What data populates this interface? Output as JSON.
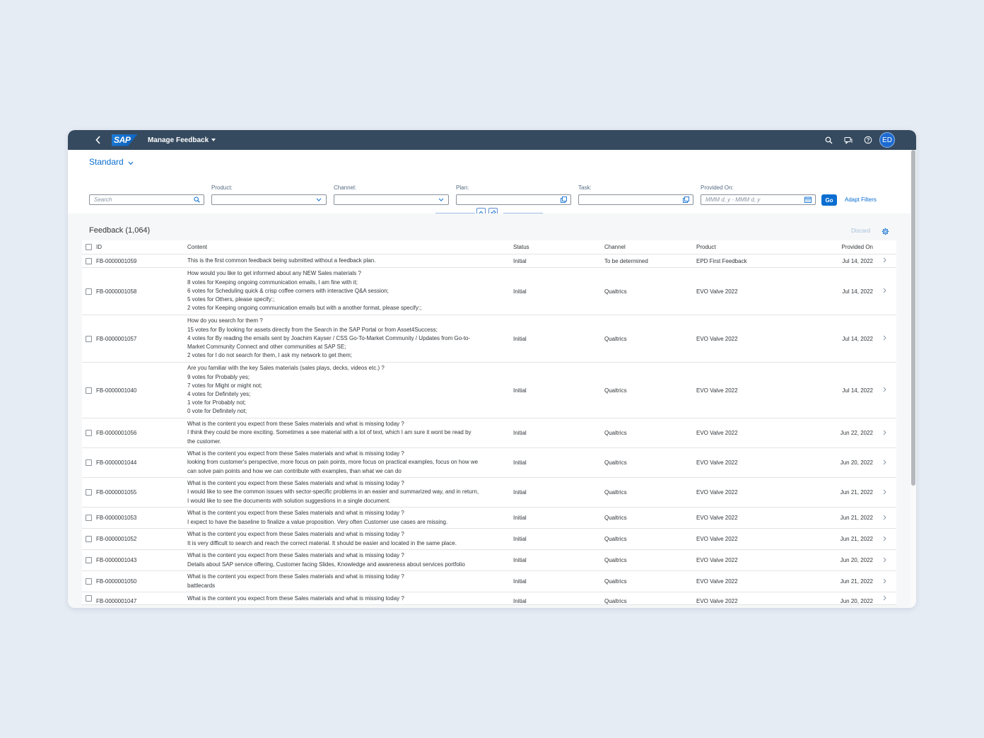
{
  "shell": {
    "app_title": "Manage Feedback",
    "logo_text": "SAP",
    "avatar_initials": "ED",
    "icons": [
      "back-icon",
      "search-icon",
      "notifications-icon",
      "help-icon"
    ]
  },
  "filterbar": {
    "variant": "Standard",
    "search_placeholder": "Search",
    "product_label": "Product:",
    "channel_label": "Channel:",
    "plan_label": "Plan:",
    "task_label": "Task:",
    "provided_on_label": "Provided On:",
    "date_placeholder": "MMM d, y - MMM d, y",
    "go_label": "Go",
    "adapt_filters_label": "Adapt Filters"
  },
  "table": {
    "title": "Feedback (1,064)",
    "discard_label": "Discard",
    "columns": {
      "id": "ID",
      "content": "Content",
      "status": "Status",
      "channel": "Channel",
      "product": "Product",
      "provided_on": "Provided On"
    },
    "rows": [
      {
        "id": "FB-0000001059",
        "content": "This is the first common feedback being submitted without a feedback plan.",
        "status": "Initial",
        "channel": "To be determined",
        "product": "EPD First Feedback",
        "date": "Jul 14, 2022"
      },
      {
        "id": "FB-0000001058",
        "content": "How would you like to get informed about any NEW Sales materials ?\n8 votes for Keeping ongoing communication emails, I am fine with it;\n6 votes for Scheduling quick & crisp coffee corners with interactive Q&A session;\n5 votes for Others, please specify:;\n2 votes for Keeping ongoing communication emails but with a another format, please specify:;",
        "status": "Initial",
        "channel": "Qualtrics",
        "product": "EVO Valve 2022",
        "date": "Jul 14, 2022"
      },
      {
        "id": "FB-0000001057",
        "content": "How do you search for them ?\n15 votes for By looking for assets directly from the Search in the SAP Portal or from Asset4Success;\n4 votes for By reading the emails sent by Joachim Kayser / CSS Go-To-Market Community / Updates from Go-to-\nMarket Community Connect and other communities at SAP SE;\n2 votes for I do not search for them, I ask my network to get them;",
        "status": "Initial",
        "channel": "Qualtrics",
        "product": "EVO Valve 2022",
        "date": "Jul 14, 2022"
      },
      {
        "id": "FB-0000001040",
        "content": "Are you familiar with the key Sales materials (sales plays, decks, videos etc.) ?\n9 votes for Probably yes;\n7 votes for Might or might not;\n4 votes for Definitely yes;\n1 vote for Probably not;\n0 vote for Definitely not;",
        "status": "Initial",
        "channel": "Qualtrics",
        "product": "EVO Valve 2022",
        "date": "Jul 14, 2022"
      },
      {
        "id": "FB-0000001056",
        "content": "What is the content you expect from these Sales materials and what is missing today ?\nI think they could be more exciting. Sometimes a see material with a lot of text, which I am sure it wont be read by\nthe customer.",
        "status": "Initial",
        "channel": "Qualtrics",
        "product": "EVO Valve 2022",
        "date": "Jun 22, 2022"
      },
      {
        "id": "FB-0000001044",
        "content": "What is the content you expect from these Sales materials and what is missing today ?\nlooking from customer's perspective, more focus on pain points, more focus on practical examples, focus on how we\ncan solve pain points and how we can contribute with examples, than what we can do",
        "status": "Initial",
        "channel": "Qualtrics",
        "product": "EVO Valve 2022",
        "date": "Jun 20, 2022"
      },
      {
        "id": "FB-0000001055",
        "content": "What is the content you expect from these Sales materials and what is missing today ?\nI would like to see the common issues with sector-specific problems in an easier and summarized way, and in return,\nI would like to see the documents with solution suggestions in a single document.",
        "status": "Initial",
        "channel": "Qualtrics",
        "product": "EVO Valve 2022",
        "date": "Jun 21, 2022"
      },
      {
        "id": "FB-0000001053",
        "content": "What is the content you expect from these Sales materials and what is missing today ?\nI expect to have the baseline to finalize a value proposition. Very often Customer use cases are missing.",
        "status": "Initial",
        "channel": "Qualtrics",
        "product": "EVO Valve 2022",
        "date": "Jun 21, 2022"
      },
      {
        "id": "FB-0000001052",
        "content": "What is the content you expect from these Sales materials and what is missing today ?\nIt is very difficult to search and reach the correct material. It should be easier and located in the same place.",
        "status": "Initial",
        "channel": "Qualtrics",
        "product": "EVO Valve 2022",
        "date": "Jun 21, 2022"
      },
      {
        "id": "FB-0000001043",
        "content": "What is the content you expect from these Sales materials and what is missing today ?\nDetails about SAP service offering, Customer facing Slides, Knowledge and awareness about services portfolio",
        "status": "Initial",
        "channel": "Qualtrics",
        "product": "EVO Valve 2022",
        "date": "Jun 20, 2022"
      },
      {
        "id": "FB-0000001050",
        "content": "What is the content you expect from these Sales materials and what is missing today ?\nbattlecards",
        "status": "Initial",
        "channel": "Qualtrics",
        "product": "EVO Valve 2022",
        "date": "Jun 21, 2022"
      },
      {
        "id": "FB-0000001047",
        "content": "What is the content you expect from these Sales materials and what is missing today ?",
        "status": "Initial",
        "channel": "Qualtrics",
        "product": "EVO Valve 2022",
        "date": "Jun 20, 2022"
      }
    ]
  },
  "colors": {
    "shell": "#354a5f",
    "accent": "#0a6ed1",
    "page_background": "#e6ecf4"
  }
}
